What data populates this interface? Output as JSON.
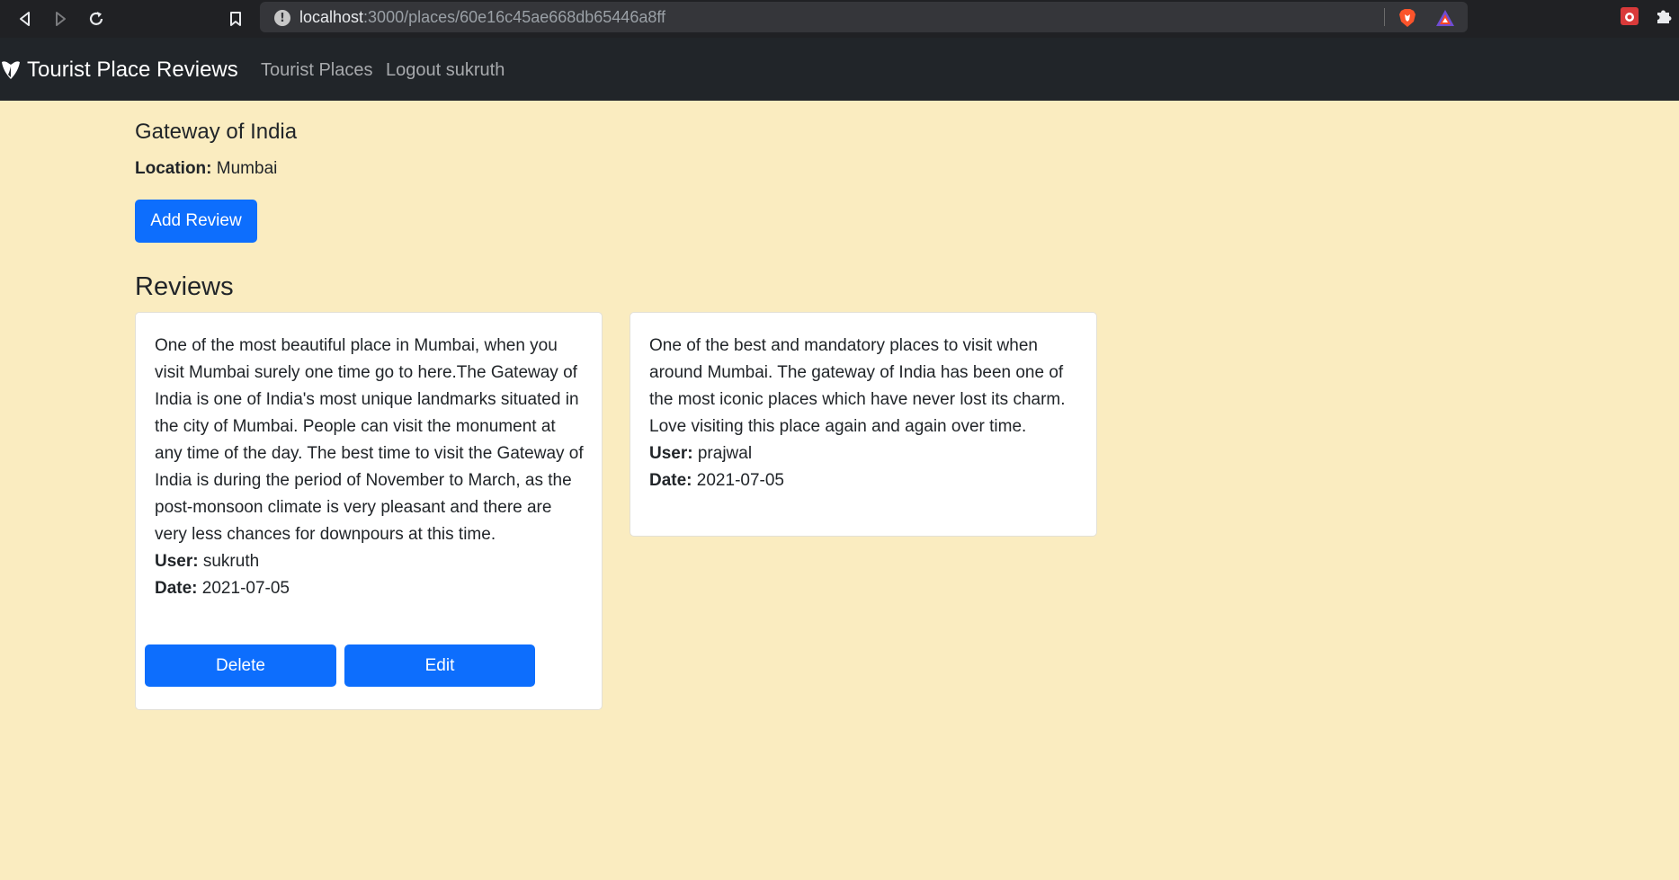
{
  "browser": {
    "url_host": "localhost",
    "url_path": ":3000/places/60e16c45ae668db65446a8ff"
  },
  "navbar": {
    "brand": "Tourist Place Reviews",
    "links": [
      "Tourist Places",
      "Logout sukruth"
    ]
  },
  "place": {
    "title": "Gateway of India",
    "location_label": "Location:",
    "location_value": "Mumbai",
    "add_review_label": "Add Review"
  },
  "reviews_heading": "Reviews",
  "reviews": [
    {
      "text": "One of the most beautiful place in Mumbai, when you visit Mumbai surely one time go to here.The Gateway of India is one of India's most unique landmarks situated in the city of Mumbai. People can visit the monument at any time of the day. The best time to visit the Gateway of India is during the period of November to March, as the post-monsoon climate is very pleasant and there are very less chances for downpours at this time.",
      "user_label": "User:",
      "user": "sukruth",
      "date_label": "Date:",
      "date": "2021-07-05",
      "delete_label": "Delete",
      "edit_label": "Edit"
    },
    {
      "text": "One of the best and mandatory places to visit when around Mumbai. The gateway of India has been one of the most iconic places which have never lost its charm. Love visiting this place again and again over time.",
      "user_label": "User:",
      "user": "prajwal",
      "date_label": "Date:",
      "date": "2021-07-05"
    }
  ],
  "colors": {
    "page_bg": "#faecc0",
    "navbar_bg": "#212529",
    "primary": "#0d6efd"
  }
}
